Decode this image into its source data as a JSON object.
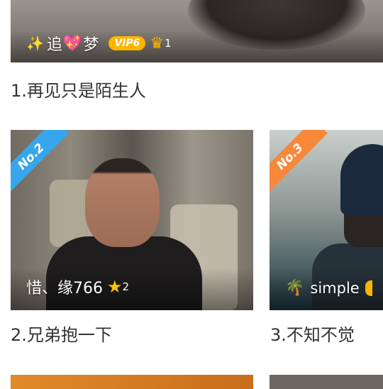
{
  "cards": [
    {
      "rank_caption": "1.再见只是陌生人",
      "user": {
        "prefix": "✨",
        "name_a": "追",
        "heart": "💖",
        "name_b": "梦",
        "vip": "VIP6",
        "crown_count": "1"
      },
      "colors": {
        "vip_badge": "#ffb400"
      }
    },
    {
      "ribbon": "No.2",
      "rank_caption": "2.兄弟抱一下",
      "user": {
        "name": "惜、缘766",
        "star_count": "2"
      },
      "colors": {
        "ribbon": "#37a6ea"
      }
    },
    {
      "ribbon": "No.3",
      "rank_caption": "3.不知不觉",
      "user": {
        "icon": "palm-tree-icon",
        "name": "simple"
      },
      "colors": {
        "ribbon": "#f7883a"
      }
    }
  ]
}
